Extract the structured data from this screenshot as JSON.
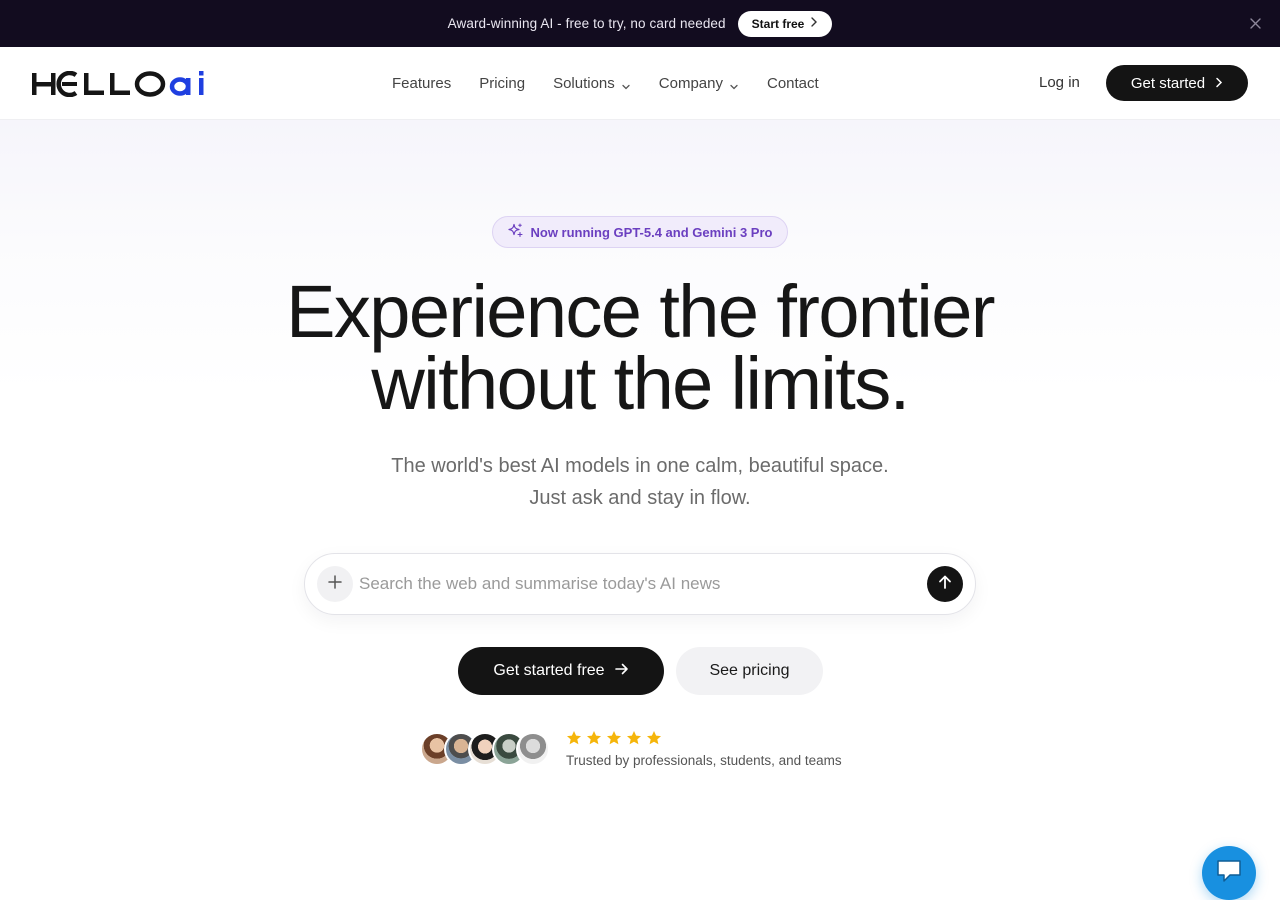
{
  "announcement": {
    "text": "Award-winning AI - free to try, no card needed",
    "button_label": "Start free",
    "icons": {
      "chevron": "chevron-right-icon",
      "close": "close-icon"
    }
  },
  "header": {
    "logo_text": "HELLOAI",
    "nav": [
      {
        "label": "Features",
        "has_dropdown": false
      },
      {
        "label": "Pricing",
        "has_dropdown": false
      },
      {
        "label": "Solutions",
        "has_dropdown": true
      },
      {
        "label": "Company",
        "has_dropdown": true
      },
      {
        "label": "Contact",
        "has_dropdown": false
      }
    ],
    "login_label": "Log in",
    "cta_label": "Get started"
  },
  "hero": {
    "badge": "Now running GPT-5.4 and Gemini 3 Pro",
    "headline_line1": "Experience the frontier",
    "headline_line2": "without the limits.",
    "subline_line1": "The world's best AI models in one calm, beautiful space.",
    "subline_line2": "Just ask and stay in flow.",
    "search_placeholder": "Search the web and summarise today's AI news",
    "primary_cta": "Get started free",
    "secondary_cta": "See pricing",
    "rating_stars": 5,
    "trusted_text": "Trusted by professionals, students, and teams"
  },
  "colors": {
    "announcement_bg": "#120c1f",
    "primary_dark": "#141414",
    "logo_accent": "#1f3fe0",
    "badge_text": "#6b3fc0",
    "star": "#f5b50a",
    "chat": "#1890e0"
  }
}
